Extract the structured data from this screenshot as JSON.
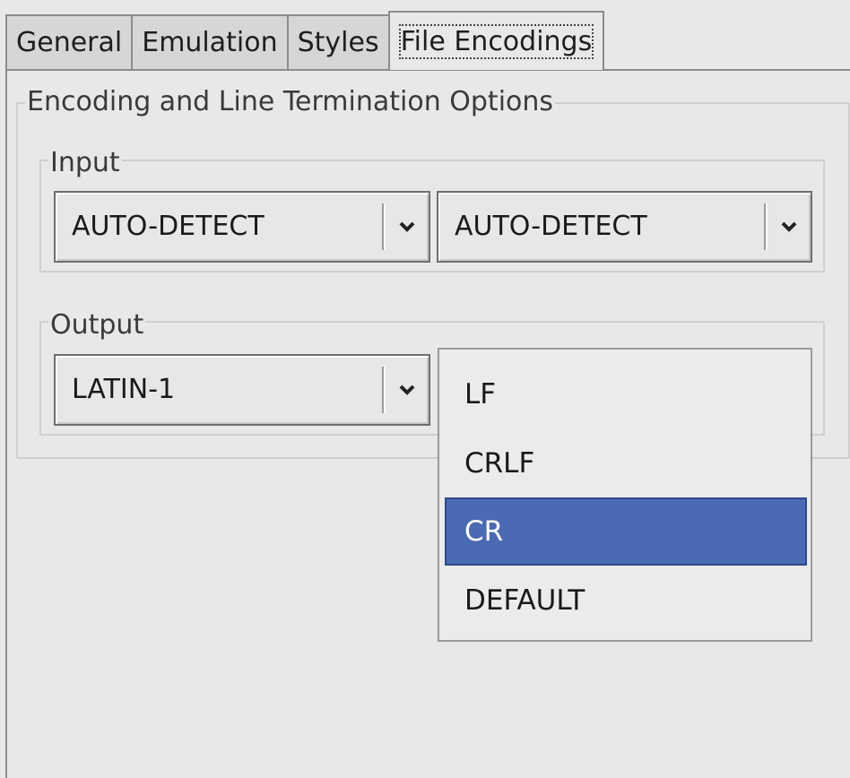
{
  "tabs": [
    {
      "label": "General"
    },
    {
      "label": "Emulation"
    },
    {
      "label": "Styles"
    },
    {
      "label": "File Encodings"
    }
  ],
  "active_tab": "File Encodings",
  "options_group": {
    "title": "Encoding and Line Termination Options"
  },
  "input_group": {
    "title": "Input",
    "encoding_value": "AUTO-DETECT",
    "line_termination_value": "AUTO-DETECT"
  },
  "output_group": {
    "title": "Output",
    "encoding_value": "LATIN-1"
  },
  "line_termination_popup": {
    "items": [
      {
        "label": "LF"
      },
      {
        "label": "CRLF"
      },
      {
        "label": "CR"
      },
      {
        "label": "DEFAULT"
      }
    ],
    "selected": "CR"
  },
  "colors": {
    "selection": "#4a6ab4",
    "background": "#e8e8e8"
  },
  "icons": {
    "combo_arrow": "chevron-down-icon"
  }
}
